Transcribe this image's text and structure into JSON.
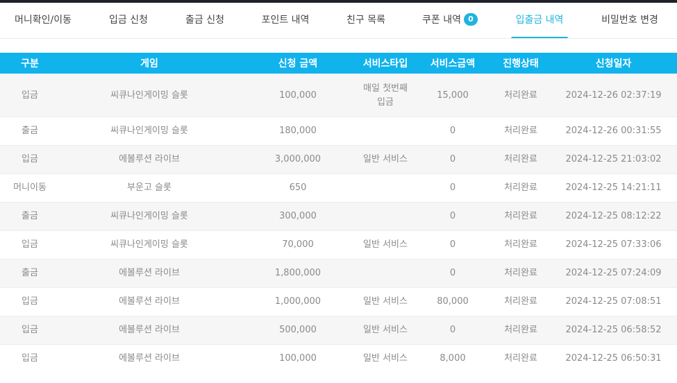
{
  "tabs": [
    {
      "label": "머니확인/이동"
    },
    {
      "label": "입금 신청"
    },
    {
      "label": "출금 신청"
    },
    {
      "label": "포인트 내역"
    },
    {
      "label": "친구 목록"
    },
    {
      "label": "쿠폰 내역",
      "badge": "0"
    },
    {
      "label": "입출금 내역",
      "active": true
    },
    {
      "label": "비밀번호 변경"
    }
  ],
  "table": {
    "headers": [
      "구분",
      "게임",
      "신청 금액",
      "서비스타입",
      "서비스금액",
      "진행상태",
      "신청일자"
    ],
    "rows": [
      [
        "입금",
        "씨큐나인게이밍 슬롯",
        "100,000",
        "매일 첫번째 입금",
        "15,000",
        "처리완료",
        "2024-12-26 02:37:19"
      ],
      [
        "출금",
        "씨큐나인게이밍 슬롯",
        "180,000",
        "",
        "0",
        "처리완료",
        "2024-12-26 00:31:55"
      ],
      [
        "입금",
        "에볼루션 라이브",
        "3,000,000",
        "일반 서비스",
        "0",
        "처리완료",
        "2024-12-25 21:03:02"
      ],
      [
        "머니이동",
        "부운고 슬롯",
        "650",
        "",
        "0",
        "처리완료",
        "2024-12-25 14:21:11"
      ],
      [
        "출금",
        "씨큐나인게이밍 슬롯",
        "300,000",
        "",
        "0",
        "처리완료",
        "2024-12-25 08:12:22"
      ],
      [
        "입금",
        "씨큐나인게이밍 슬롯",
        "70,000",
        "일반 서비스",
        "0",
        "처리완료",
        "2024-12-25 07:33:06"
      ],
      [
        "출금",
        "에볼루션 라이브",
        "1,800,000",
        "",
        "0",
        "처리완료",
        "2024-12-25 07:24:09"
      ],
      [
        "입금",
        "에볼루션 라이브",
        "1,000,000",
        "일반 서비스",
        "80,000",
        "처리완료",
        "2024-12-25 07:08:51"
      ],
      [
        "입금",
        "에볼루션 라이브",
        "500,000",
        "일반 서비스",
        "0",
        "처리완료",
        "2024-12-25 06:58:52"
      ],
      [
        "입금",
        "에볼루션 라이브",
        "100,000",
        "일반 서비스",
        "8,000",
        "처리완료",
        "2024-12-25 06:50:31"
      ]
    ]
  },
  "colors": {
    "accent": "#1fb3e0",
    "header_bg": "#10b3ec"
  }
}
